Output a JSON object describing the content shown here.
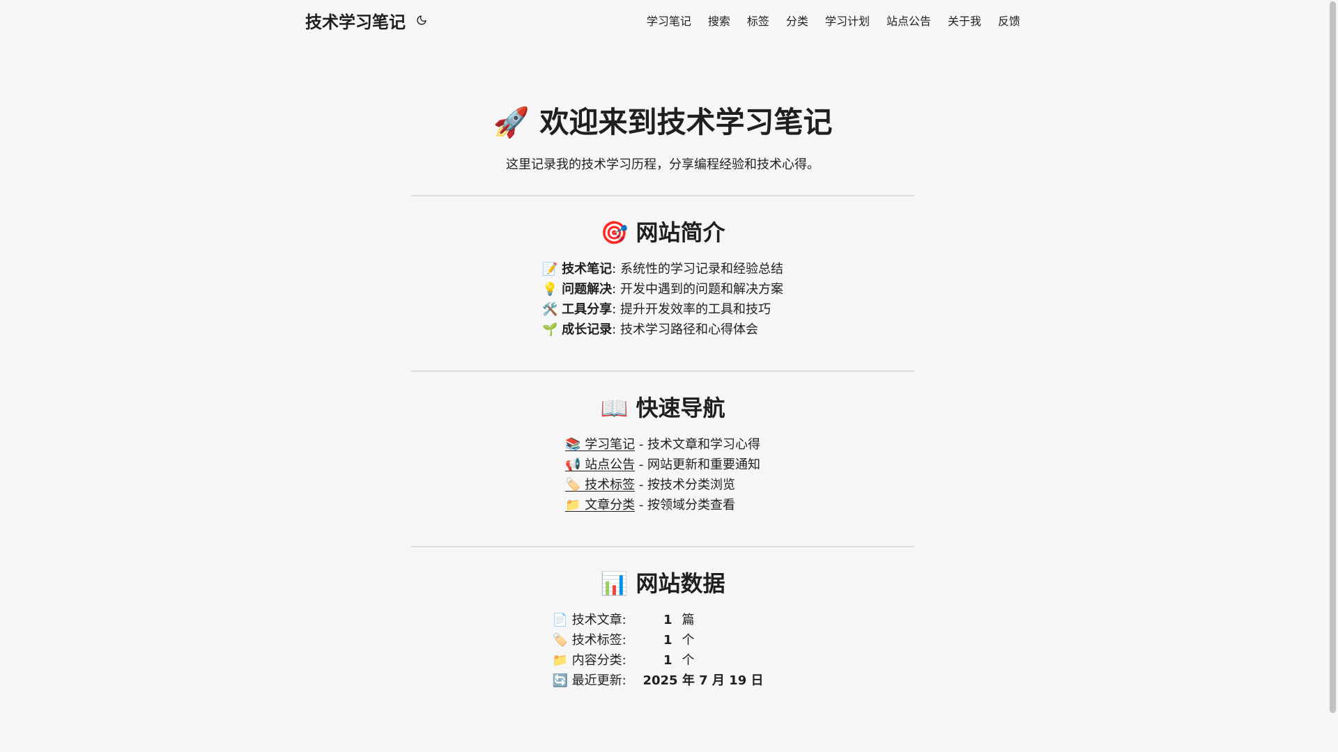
{
  "header": {
    "site_title": "技术学习笔记",
    "theme_toggle_icon": "moon-icon",
    "nav": [
      "学习笔记",
      "搜索",
      "标签",
      "分类",
      "学习计划",
      "站点公告",
      "关于我",
      "反馈"
    ]
  },
  "hero": {
    "title": "🚀 欢迎来到技术学习笔记",
    "subtitle": "这里记录我的技术学习历程，分享编程经验和技术心得。"
  },
  "intro": {
    "title": "🎯 网站简介",
    "items": [
      {
        "icon": "📝",
        "label": "技术笔记",
        "desc": ": 系统性的学习记录和经验总结"
      },
      {
        "icon": "💡",
        "label": "问题解决",
        "desc": ": 开发中遇到的问题和解决方案"
      },
      {
        "icon": "🛠️",
        "label": "工具分享",
        "desc": ": 提升开发效率的工具和技巧"
      },
      {
        "icon": "🌱",
        "label": "成长记录",
        "desc": ": 技术学习路径和心得体会"
      }
    ]
  },
  "quicknav": {
    "title": "📖 快速导航",
    "items": [
      {
        "link": "📚 学习笔记",
        "desc": " - 技术文章和学习心得"
      },
      {
        "link": "📢 站点公告",
        "desc": " - 网站更新和重要通知"
      },
      {
        "link": "🏷️ 技术标签",
        "desc": " - 按技术分类浏览"
      },
      {
        "link": "📁 文章分类",
        "desc": " - 按领域分类查看"
      }
    ]
  },
  "stats": {
    "title": "📊 网站数据",
    "rows": [
      {
        "label": "📄 技术文章:",
        "value": "1",
        "unit": "篇"
      },
      {
        "label": "🏷️ 技术标签:",
        "value": "1",
        "unit": "个"
      },
      {
        "label": "📁 内容分类:",
        "value": "1",
        "unit": "个"
      },
      {
        "label": "🔄 最近更新:",
        "value": "2025 年 7 月 19 日",
        "unit": ""
      }
    ]
  }
}
